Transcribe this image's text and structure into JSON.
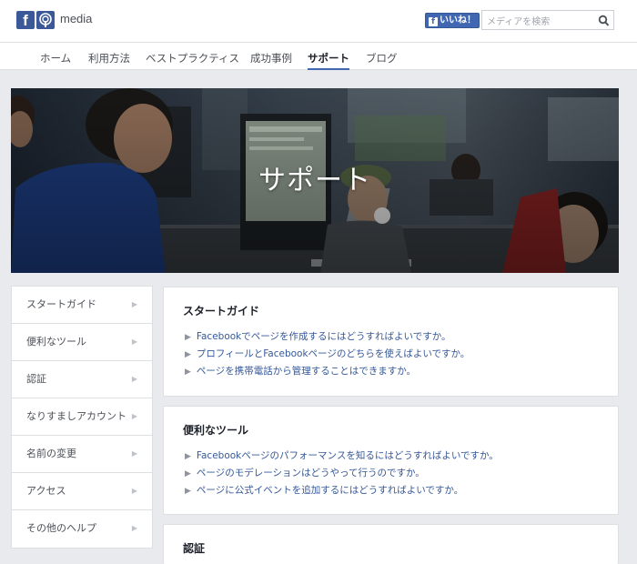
{
  "header": {
    "brand_text": "media",
    "like_label": "いいね！",
    "search_placeholder": "メディアを検索"
  },
  "nav": {
    "tabs": [
      {
        "label": "ホーム",
        "active": false
      },
      {
        "label": "利用方法",
        "active": false
      },
      {
        "label": "ベストプラクティス",
        "active": false
      },
      {
        "label": "成功事例",
        "active": false
      },
      {
        "label": "サポート",
        "active": true
      },
      {
        "label": "ブログ",
        "active": false
      }
    ]
  },
  "hero": {
    "title": "サポート"
  },
  "sidebar": {
    "items": [
      {
        "label": "スタートガイド"
      },
      {
        "label": "便利なツール"
      },
      {
        "label": "認証"
      },
      {
        "label": "なりすましアカウント"
      },
      {
        "label": "名前の変更"
      },
      {
        "label": "アクセス"
      },
      {
        "label": "その他のヘルプ"
      }
    ]
  },
  "cards": [
    {
      "title": "スタートガイド",
      "links": [
        "Facebookでページを作成するにはどうすればよいですか。",
        "プロフィールとFacebookページのどちらを使えばよいですか。",
        "ページを携帯電話から管理することはできますか。"
      ]
    },
    {
      "title": "便利なツール",
      "links": [
        "Facebookページのパフォーマンスを知るにはどうすればよいですか。",
        "ページのモデレーションはどうやって行うのですか。",
        "ページに公式イベントを追加するにはどうすればよいですか。"
      ]
    },
    {
      "title": "認証",
      "links": []
    }
  ],
  "colors": {
    "brand": "#3b5998",
    "link": "#365899",
    "background": "#e9eaed"
  }
}
